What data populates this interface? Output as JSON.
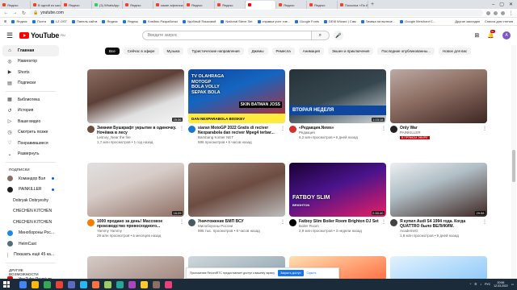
{
  "browser": {
    "tabs": [
      {
        "label": "Яндекс",
        "color": "#fc3f1d"
      },
      {
        "label": "В одной из школ Ярославской",
        "color": "#fc3f1d"
      },
      {
        "label": "Яндекс",
        "color": "#fc3f1d"
      },
      {
        "label": "(3) WhatsApp",
        "color": "#25d366"
      },
      {
        "label": "Яндекс",
        "color": "#fc3f1d"
      },
      {
        "label": "какие афганской 300 купить",
        "color": "#fc3f1d"
      },
      {
        "label": "Яндекс",
        "color": "#fc3f1d"
      },
      {
        "label": "Яндекс",
        "color": "#fc3f1d"
      },
      {
        "label": "",
        "color": "#ff0000",
        "active": true
      },
      {
        "label": "Яндекс",
        "color": "#fc3f1d"
      },
      {
        "label": "Яндекс",
        "color": "#fc3f1d"
      },
      {
        "label": "Посылка «По АРВ» — Gebirke",
        "color": "#fc3f1d"
      }
    ],
    "url": "youtube.com",
    "bookmarks": [
      "Яндекс",
      "Почта",
      "LZ.OST",
      "Панель сайта",
      "Яндекс",
      "Яндекс",
      "Клеймо Разработки",
      "Удобный Языковой",
      "National Steve Set",
      "справка учет тов...",
      "Google Fonts",
      "DEM Wizard | Сам",
      "Заявка на включе...",
      "Google Merchant C..."
    ],
    "bookmarks_right": [
      "Другие закладки",
      "Список для чтения"
    ]
  },
  "header": {
    "logo_text": "YouTube",
    "logo_cc": "RU",
    "search_placeholder": "Введите запрос",
    "notif_count": "9+",
    "avatar_letter": "А"
  },
  "sidebar": {
    "main": [
      {
        "label": "Главная",
        "icon": "⌂",
        "active": true
      },
      {
        "label": "Навигатор",
        "icon": "◎"
      },
      {
        "label": "Shorts",
        "icon": "▶"
      },
      {
        "label": "Подписки",
        "icon": "▤"
      }
    ],
    "library": [
      {
        "label": "Библиотека",
        "icon": "▦"
      },
      {
        "label": "История",
        "icon": "↺"
      },
      {
        "label": "Ваши видео",
        "icon": "▷"
      },
      {
        "label": "Смотреть позже",
        "icon": "◷"
      },
      {
        "label": "Понравившиеся",
        "icon": "♡"
      },
      {
        "label": "Развернуть",
        "icon": "⌄"
      }
    ],
    "subs_heading": "ПОДПИСКИ",
    "subs": [
      {
        "label": "Командор Вэл",
        "color": "#8d6e63"
      },
      {
        "label": "PAINKILLER",
        "color": "#212121"
      },
      {
        "label": "Dobryak Dobryeshy",
        "color": "#43a047"
      },
      {
        "label": "CHECHEN KITCHEN",
        "color": "#e53935"
      },
      {
        "label": "CHECHEN KITCHEN",
        "color": "#e53935"
      },
      {
        "label": "Минобороны Рос...",
        "color": "#1e88e5"
      },
      {
        "label": "HelmCast",
        "color": "#546e7a"
      },
      {
        "label": "Показать ещё 45 ка...",
        "color": "#bdbdbd"
      }
    ],
    "other_heading": "ДРУГИЕ ВОЗМОЖНОСТИ",
    "other": [
      {
        "label": "YouTube Premium",
        "color": "#ff0000"
      }
    ]
  },
  "chips": [
    "Все",
    "Сейчас в эфире",
    "Музыка",
    "Туристические направления",
    "Джемы",
    "Ремесла",
    "Анимация",
    "Экшен и приключения",
    "Последние опубликованны...",
    "Новое для вас"
  ],
  "videos": [
    {
      "title": "Зимняя Бушкрафт укрытие в одиночку. Ночёвка в лесу",
      "channel": "Lesnoy_Near the fire",
      "stats": "1,7 млн просмотров • 1 год назад",
      "duration": "25:36",
      "av": "#6d4c41"
    },
    {
      "title": "siaran MotoGP 2022 Gratis di reciver Nexparabola dan reciver Mpeg4 terbar...",
      "channel": "Bambang Konter NET",
      "stats": "586 просмотров • 5 часов назад",
      "duration": "",
      "av": "#1976d2"
    },
    {
      "title": "«Редакция.News»",
      "channel": "Редакция",
      "stats": "6,2 млн просмотров • 6 дней назад",
      "duration": "1:03:18",
      "av": "#d32f2f"
    },
    {
      "title": "Only War",
      "channel": "PAINKILLER",
      "stats": "",
      "duration": "",
      "badge": "В ПРЯМОМ ЭФИРЕ",
      "av": "#212121"
    },
    {
      "title": "1000 продано за день! Массовое производство превосходного...",
      "channel": "Yammy Yammy",
      "stats": "29 млн просмотров • 6 месяцев назад",
      "duration": "16:29",
      "av": "#f57c00"
    },
    {
      "title": "Уничтожение БМП ВСУ",
      "channel": "Минобороны России",
      "stats": "995 тыс. просмотров • 8 часов назад",
      "duration": "",
      "av": "#455a64"
    },
    {
      "title": "Fatboy Slim Boiler Room Brighton DJ Set",
      "channel": "Boiler Room",
      "stats": "2,9 млн просмотров • 3 недели назад",
      "duration": "2:50:40",
      "av": "#000000"
    },
    {
      "title": "Я купил Audi S4 1994 года. Когда QUATTRO было ВЕЛИКИМ.",
      "channel": "AcademeG",
      "stats": "1,8 млн просмотров • 9 дней назад",
      "duration": "29:58",
      "av": "#424242"
    }
  ],
  "thumbs": {
    "t2_title_lines": [
      "TV OLAHRAGA",
      "MOTOGP",
      "BOLA VOLLY",
      "SEPAK BOLA"
    ],
    "t2_banner": "SKIN BATMAN JOSS",
    "t2_footer": "DAN NEXPARABOLA BISSKEY",
    "t3_banner": "ВТОРАЯ НЕДЕЛЯ",
    "t7_text": "FATBOY SLIM",
    "t7_sub": "BRIGHTON"
  },
  "notification": {
    "text": "Приложение RecordRTC предоставляет доступ к вашему экрану",
    "stop": "Закрыть доступ",
    "hide": "Скрыть"
  },
  "taskbar": {
    "time": "20:56",
    "date": "12.03.2022",
    "lang": "РУС",
    "apps": [
      "#4285f4",
      "#fbbc05",
      "#34a853",
      "#ea4335",
      "#5c6bc0",
      "#29b6f6",
      "#ff7043",
      "#9ccc65",
      "#26a69a",
      "#ab47bc",
      "#ffca28",
      "#8d6e63",
      "#ec407a"
    ]
  }
}
